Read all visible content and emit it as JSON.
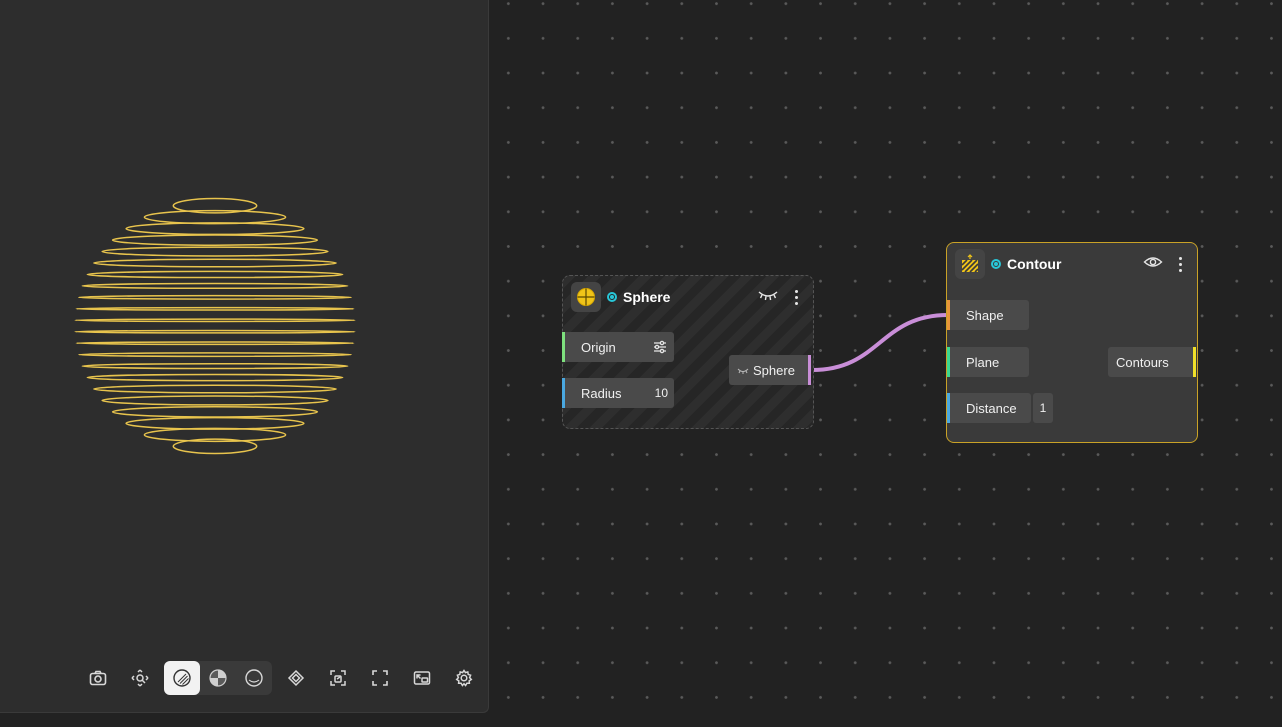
{
  "viewport": {
    "toolbar": [
      {
        "name": "camera-icon",
        "active": false
      },
      {
        "name": "move-view-icon",
        "active": false
      },
      {
        "name": "shading-solid-icon",
        "active": true
      },
      {
        "name": "shading-checker-icon",
        "active": false
      },
      {
        "name": "shading-wire-icon",
        "active": false
      },
      {
        "name": "layers-icon",
        "active": false
      },
      {
        "name": "zoom-selection-icon",
        "active": false
      },
      {
        "name": "fullscreen-icon",
        "active": false
      },
      {
        "name": "picture-in-picture-icon",
        "active": false
      },
      {
        "name": "settings-gear-icon",
        "active": false
      }
    ],
    "sphere_color": "#e8c44d"
  },
  "nodes": {
    "sphere": {
      "title": "Sphere",
      "icon": "sphere-icon",
      "visibility": "hidden",
      "inputs": [
        {
          "label": "Origin",
          "value_icon": "sliders-icon",
          "color": "#7ee07e"
        },
        {
          "label": "Radius",
          "value": "10",
          "color": "#4aa8e0"
        }
      ],
      "outputs": [
        {
          "label": "Sphere",
          "color": "#c98ed8"
        }
      ]
    },
    "contour": {
      "title": "Contour",
      "icon": "contour-icon",
      "visibility": "visible",
      "border_color": "#c9a227",
      "inputs": [
        {
          "label": "Shape",
          "color": "#e8953a"
        },
        {
          "label": "Plane",
          "color": "#3ad890"
        },
        {
          "label": "Distance",
          "value": "1",
          "color": "#4aa8e0"
        }
      ],
      "outputs": [
        {
          "label": "Contours",
          "color": "#f0e02a"
        }
      ]
    }
  },
  "wire_color": "#c98ed8"
}
